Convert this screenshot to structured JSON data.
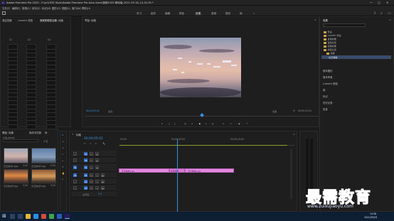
{
  "window": {
    "title": "Adobe Premiere Pro 2020 - F:\\pr\\1933 Style\\Adobe Premiere Pro Auto-Save\\视频1933 移动版-2021-09-18_14-34-30 *",
    "controls": [
      "—",
      "□",
      "✕"
    ]
  },
  "menu": {
    "items": [
      "文件(F)",
      "编辑(E)",
      "剪辑(C)",
      "序列(S)",
      "标记(M)",
      "图形(G)",
      "视图(V)",
      "窗口(W)",
      "帮助(H)"
    ]
  },
  "workspaces": {
    "items": [
      "学习",
      "组件",
      "编辑",
      "颜色",
      "效果",
      "音频",
      "图形",
      "库"
    ],
    "active_index": 4,
    "overflow": "»"
  },
  "audio_meters": {
    "tabs": [
      "源监视器",
      "Lumetri 范围",
      "音频剪辑混合器: 片段",
      "音频"
    ],
    "channels": [
      "A1",
      "A2",
      "A3"
    ]
  },
  "program_monitor": {
    "tab": "节目: 片段",
    "current_time": "00;00;05;02",
    "zoom": "适合",
    "quality": "完整",
    "duration": "00;00;10;00",
    "menu_icon": "hamburger-icon"
  },
  "project": {
    "tabs": [
      "项目: 片段",
      "媒体浏览器",
      "库",
      "信息"
    ],
    "path": "片段.prproj",
    "search_placeholder": "",
    "item_count": "4 项",
    "items": [
      {
        "name": "天空素材1.jpg",
        "duration": "5;00",
        "color": "#c89b86"
      },
      {
        "name": "天空素材2.jpg",
        "duration": "5;00",
        "color": "#6f87a6"
      },
      {
        "name": "天空素材3.jpg",
        "duration": "5;00",
        "color": "#d68a52"
      },
      {
        "name": "天空素材4.jpg",
        "duration": "5;00",
        "color": "#b0753f"
      }
    ]
  },
  "timeline": {
    "tab": "片段",
    "timecode": "00;00;05;02",
    "ruler": [
      "00;00",
      "00;00;05;00",
      "00;00;10;00"
    ],
    "video_tracks": [
      "V3",
      "V2",
      "V1"
    ],
    "audio_tracks": [
      "A1",
      "A2",
      "A3"
    ],
    "master": "主声道",
    "master_value": "0.0",
    "source_patch_video": "V1",
    "source_patch_audio": "A1",
    "clips": [
      {
        "label": "天空素材1.jpg",
        "track": "V1"
      },
      {
        "label": "交叉溶解",
        "track": "V1"
      },
      {
        "label": "天空素材2.jpg",
        "track": "V1"
      }
    ]
  },
  "effects_panel": {
    "tab": "效果",
    "search_placeholder": "",
    "tree": [
      {
        "label": "预设",
        "indent": 0
      },
      {
        "label": "Lumetri 预设",
        "indent": 0
      },
      {
        "label": "音频效果",
        "indent": 0
      },
      {
        "label": "音频过渡",
        "indent": 0
      },
      {
        "label": "视频效果",
        "indent": 0
      },
      {
        "label": "视频过渡",
        "indent": 0
      },
      {
        "label": "溶解",
        "indent": 1
      },
      {
        "label": "交叉溶解",
        "indent": 2
      }
    ],
    "sections": [
      "基本图形",
      "基本声音",
      "Lumetri 颜色",
      "库",
      "标记",
      "历史记录",
      "信息"
    ]
  },
  "taskbar": {
    "time": "14:36",
    "date": "2021/09/18"
  },
  "watermark": {
    "text": "最需教育",
    "url": "www.zuixujiaoyu.com"
  }
}
